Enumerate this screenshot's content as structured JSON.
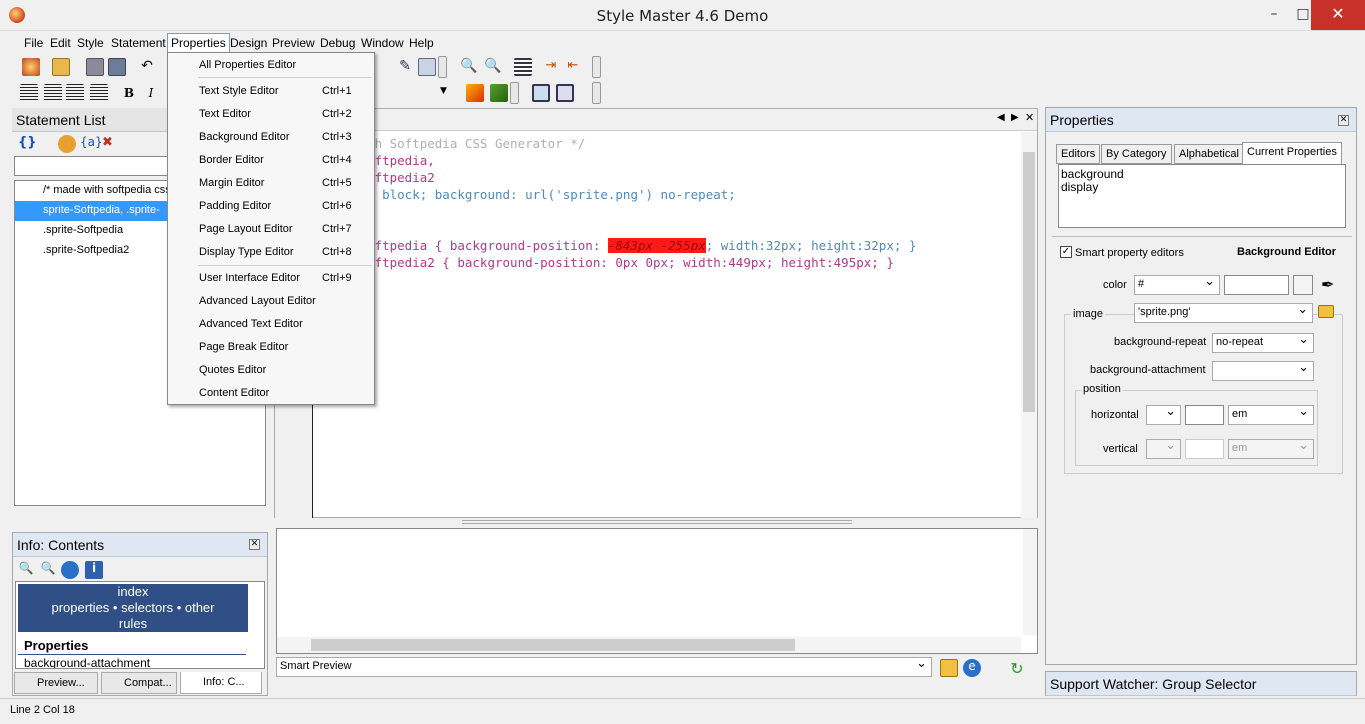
{
  "window": {
    "title": "Style Master 4.6 Demo",
    "min": "–",
    "max": "□",
    "close": "✕"
  },
  "menu": [
    "File",
    "Edit",
    "Style",
    "Statement",
    "Properties",
    "Design",
    "Preview",
    "Debug",
    "Window",
    "Help"
  ],
  "statement_list": {
    "title": "Statement List",
    "items": [
      "/* made with softpedia css",
      "sprite-Softpedia, .sprite-",
      ".sprite-Softpedia",
      ".sprite-Softpedia2"
    ]
  },
  "properties_menu": {
    "items": [
      {
        "label": "All Properties Editor",
        "shortcut": ""
      },
      {
        "label": "Text Style Editor",
        "shortcut": "Ctrl+1"
      },
      {
        "label": "Text Editor",
        "shortcut": "Ctrl+2"
      },
      {
        "label": "Background Editor",
        "shortcut": "Ctrl+3"
      },
      {
        "label": "Border Editor",
        "shortcut": "Ctrl+4"
      },
      {
        "label": "Margin Editor",
        "shortcut": "Ctrl+5"
      },
      {
        "label": "Padding Editor",
        "shortcut": "Ctrl+6"
      },
      {
        "label": "Page Layout Editor",
        "shortcut": "Ctrl+7"
      },
      {
        "label": "Display Type Editor",
        "shortcut": "Ctrl+8"
      },
      {
        "label": "User Interface Editor",
        "shortcut": "Ctrl+9"
      },
      {
        "label": "Advanced Layout Editor",
        "shortcut": ""
      },
      {
        "label": "Advanced Text Editor",
        "shortcut": ""
      },
      {
        "label": "Page Break Editor",
        "shortcut": ""
      },
      {
        "label": "Quotes Editor",
        "shortcut": ""
      },
      {
        "label": "Content Editor",
        "shortcut": ""
      }
    ]
  },
  "editor": {
    "lines": [
      "with Softpedia CSS Generator */",
      "-Softpedia,",
      "-Softpedia2",
      "ay: block; background: url('sprite.png') no-repeat;",
      "-Softpedia { background-position: ",
      "-843px -255px",
      "; width:32px; height:32px; }",
      "-Softpedia2 { background-position: 0px 0px; width:449px; height:495px; }"
    ]
  },
  "info": {
    "title": "Info: Contents",
    "nav_line1": "index",
    "nav_line2": "properties • selectors • other",
    "nav_line3": "rules",
    "heading": "Properties",
    "item": "background-attachment",
    "tabs": [
      "Preview...",
      "Compat...",
      "Info: C..."
    ]
  },
  "preview": {
    "select": "Smart Preview"
  },
  "properties_panel": {
    "title": "Properties",
    "tabs": [
      "Editors",
      "By Category",
      "Alphabetical",
      "Current Properties"
    ],
    "current": [
      "background",
      "display"
    ],
    "smart_label": "Smart property editors",
    "editor_title": "Background Editor",
    "color_label": "color",
    "color_value": "#",
    "image_label": "image",
    "image_value": "'sprite.png'",
    "repeat_label": "background-repeat",
    "repeat_value": "no-repeat",
    "attach_label": "background-attachment",
    "attach_value": "",
    "position_label": "position",
    "horiz_label": "horizontal",
    "horiz_unit": "em",
    "vert_label": "vertical",
    "vert_unit": "em"
  },
  "support": {
    "title": "Support Watcher: Group Selector"
  },
  "status": {
    "text": "Line 2 Col 18"
  }
}
